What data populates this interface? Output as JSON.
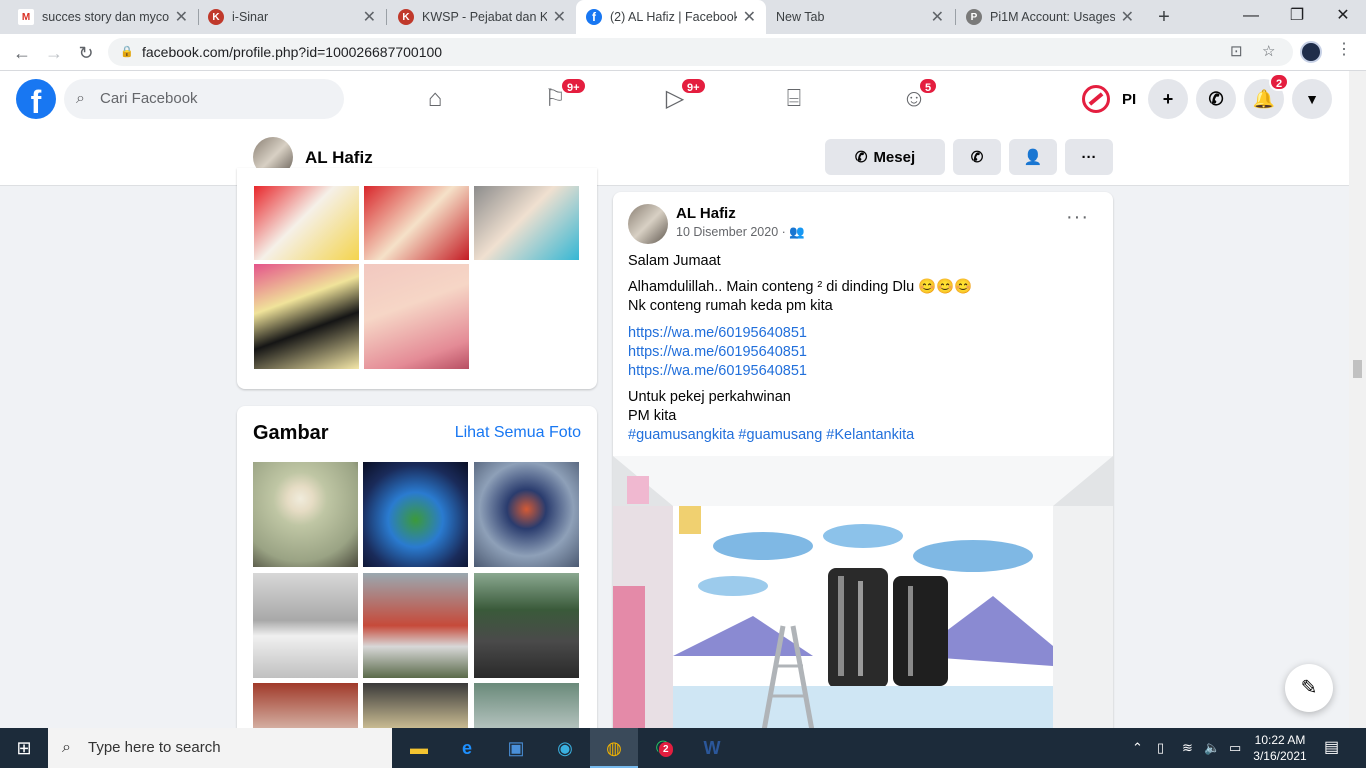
{
  "browser": {
    "tabs": [
      {
        "title": "succes story dan mycon",
        "icon": "gmail-icon"
      },
      {
        "title": "i-Sinar",
        "icon": "kwsp-icon"
      },
      {
        "title": "KWSP - Pejabat dan Kio",
        "icon": "kwsp-icon"
      },
      {
        "title": "(2) AL Hafiz | Facebook",
        "icon": "facebook-icon"
      },
      {
        "title": "New Tab",
        "icon": ""
      },
      {
        "title": "Pi1M Account: Usages",
        "icon": "pi1m-icon"
      }
    ],
    "active_tab": 3,
    "url": "facebook.com/profile.php?id=100026687700100"
  },
  "fb": {
    "search_placeholder": "Cari Facebook",
    "badges": {
      "pages": "9+",
      "watch": "9+",
      "groups": "5",
      "notifications": "2"
    },
    "user_short": "PI"
  },
  "profile": {
    "name": "AL Hafiz",
    "message_label": "Mesej"
  },
  "gallery": {
    "title": "Gambar",
    "see_all": "Lihat Semua Foto"
  },
  "post": {
    "author": "AL Hafiz",
    "date": "10 Disember 2020 ·",
    "line1": "Salam Jumaat",
    "line2": "Alhamdulillah.. Main conteng ² di dinding Dlu 😊😊😊",
    "line3": "Nk conteng rumah keda pm kita",
    "links": [
      "https://wa.me/60195640851",
      "https://wa.me/60195640851",
      "https://wa.me/60195640851"
    ],
    "line4": "Untuk pekej perkahwinan",
    "line5": "PM kita",
    "hashtags": "#guamusangkita #guamusang #Kelantankita"
  },
  "taskbar": {
    "search_placeholder": "Type here to search",
    "time": "10:22 AM",
    "date": "3/16/2021",
    "whatsapp_badge": "2"
  },
  "colors": {
    "fb_blue": "#1877f2",
    "badge_red": "#e41e3f",
    "link": "#216fdb",
    "page_bg": "#f0f2f5"
  }
}
